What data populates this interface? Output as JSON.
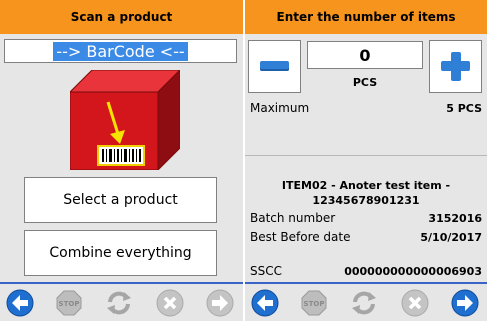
{
  "left": {
    "header_title": "Scan a product",
    "barcode_value": "--> BarCode <--",
    "select_product_label": "Select a product",
    "combine_everything_label": "Combine everything"
  },
  "right": {
    "header_title": "Enter the number of items",
    "quantity": "0",
    "unit": "PCS",
    "maximum_label": "Maximum",
    "maximum_value": "5 PCS",
    "item_title_line1": "ITEM02 - Anoter test item -",
    "item_title_line2": "12345678901231",
    "batch_label": "Batch number",
    "batch_value": "3152016",
    "best_before_label": "Best Before date",
    "best_before_value": "5/10/2017",
    "sscc_label": "SSCC",
    "sscc_value": "000000000000006903"
  },
  "footer_icons": [
    "back-icon",
    "stop-icon",
    "refresh-icon",
    "cancel-icon",
    "forward-icon"
  ],
  "colors": {
    "header": "#f7941d",
    "panel_bg": "#e6e6e6",
    "accent_blue": "#2f7fd6",
    "footer_border": "#3a64c8",
    "box_red": "#d3151c"
  }
}
